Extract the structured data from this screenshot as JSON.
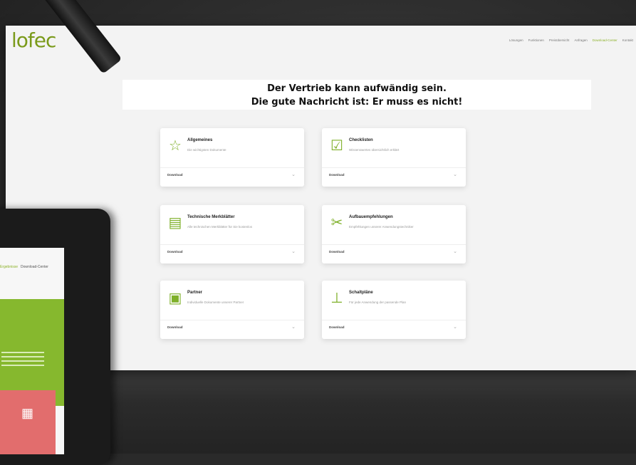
{
  "site": {
    "logo_text": "lofec"
  },
  "nav": {
    "items": [
      "Lösungen",
      "Funktionen",
      "Preisübersicht",
      "Anfragen",
      "Download-Center",
      "Kontakt"
    ],
    "active_index": 4
  },
  "hero": {
    "line1": "Der Vertrieb kann aufwändig sein.",
    "line2": "Die gute Nachricht ist: Er muss es nicht!"
  },
  "cards": [
    {
      "icon": "star-icon",
      "glyph": "☆",
      "title": "Allgemeines",
      "subtitle": "Die wichtigsten Dokumente",
      "download_label": "Download"
    },
    {
      "icon": "checklist-icon",
      "glyph": "☑",
      "title": "Checklisten",
      "subtitle": "Wissenswertes übersichtlich erklärt",
      "download_label": "Download"
    },
    {
      "icon": "document-icon",
      "glyph": "▤",
      "title": "Technische Merkblätter",
      "subtitle": "Alle technischen Merkblätter für Sie kostenlos",
      "download_label": "Download"
    },
    {
      "icon": "tools-icon",
      "glyph": "✂",
      "title": "Aufbauempfehlungen",
      "subtitle": "Empfehlungen unserer Anwendungstechniker",
      "download_label": "Download"
    },
    {
      "icon": "partner-icon",
      "glyph": "▣",
      "title": "Partner",
      "subtitle": "Individuelle Dokumente unserer Partner",
      "download_label": "Download"
    },
    {
      "icon": "hierarchy-icon",
      "glyph": "⊥",
      "title": "Schaltpläne",
      "subtitle": "Für jede Anwendung der passende Plan",
      "download_label": "Download"
    }
  ],
  "tablet": {
    "nav_left": "Ergebnisse",
    "nav_right": "Download-Center"
  },
  "colors": {
    "accent": "#86b82e",
    "tablet_red": "#e26d6d"
  }
}
